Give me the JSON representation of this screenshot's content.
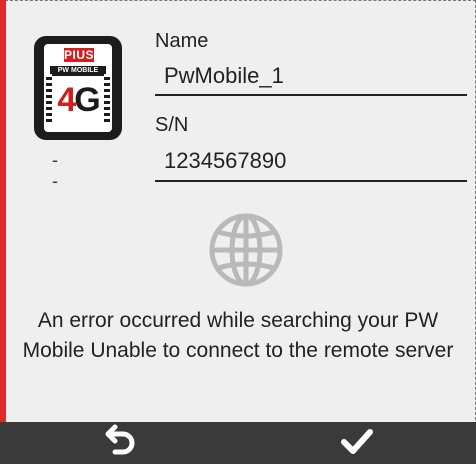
{
  "device": {
    "brand": "PIUSI",
    "model": "PW MOBILE",
    "badge_four": "4",
    "badge_g": "G",
    "status": "- -"
  },
  "fields": {
    "name_label": "Name",
    "name_value": "PwMobile_1",
    "sn_label": "S/N",
    "sn_value": "1234567890"
  },
  "icons": {
    "globe": "globe-icon",
    "undo": "undo-icon",
    "confirm": "checkmark-icon"
  },
  "message": {
    "error": "An error occurred while searching your PW Mobile Unable to connect to the remote server"
  },
  "colors": {
    "accent": "#e12b2b",
    "bar": "#3a3a3a",
    "background": "#efefef"
  }
}
